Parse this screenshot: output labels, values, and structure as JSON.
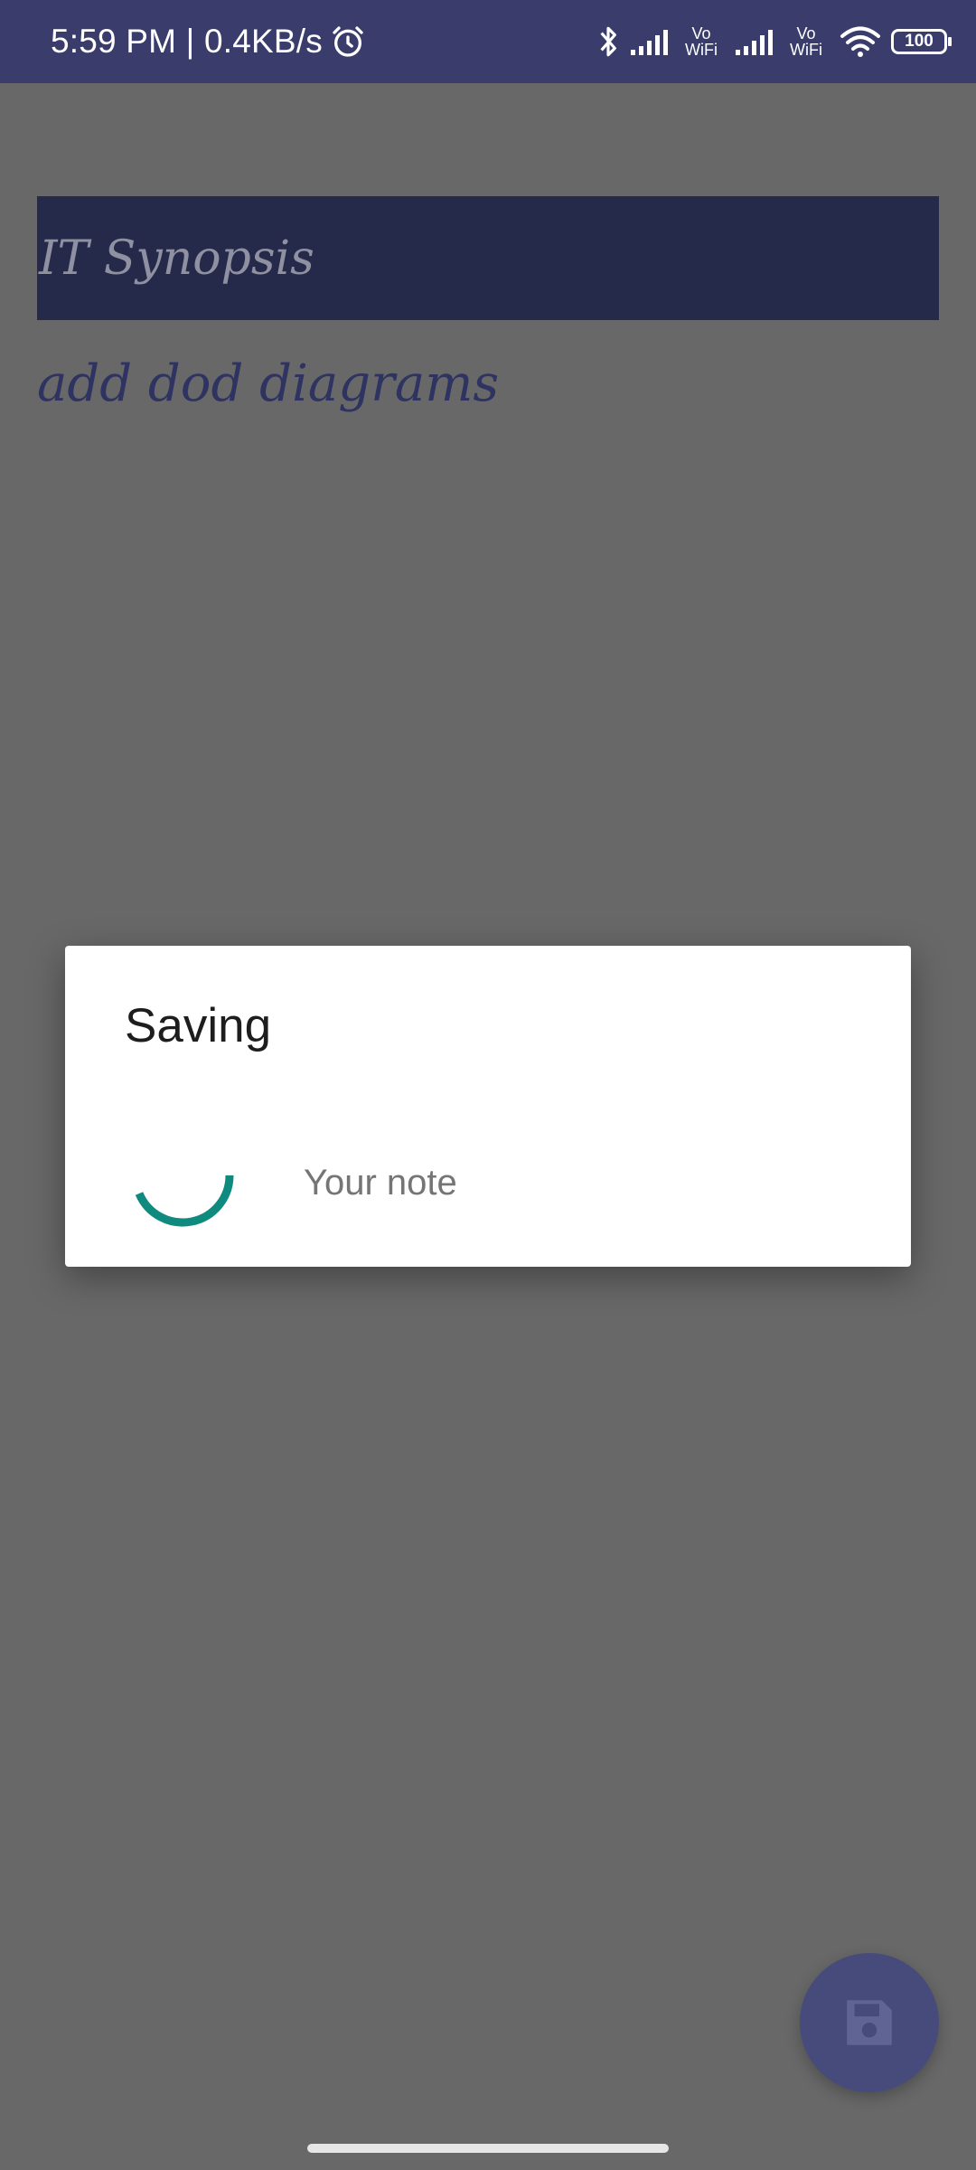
{
  "status_bar": {
    "time_speed": "5:59 PM | 0.4KB/s",
    "vowifi_top": "Vo",
    "vowifi_bottom": "WiFi",
    "battery": "100",
    "icons": [
      "alarm-icon",
      "bluetooth-icon",
      "signal-icon",
      "vowifi-icon",
      "signal-icon",
      "vowifi-icon",
      "wifi-icon",
      "battery-icon"
    ]
  },
  "note": {
    "title": "IT Synopsis",
    "body": "add dod diagrams"
  },
  "dialog": {
    "title": "Saving",
    "message": "Your note"
  },
  "fab": {
    "icon": "save-icon"
  },
  "colors": {
    "status_bar": "#3a3c6b",
    "scrim": "#686868",
    "title_field": "#262a4a",
    "spinner": "#0f8a7e",
    "fab": "#474b7b"
  }
}
